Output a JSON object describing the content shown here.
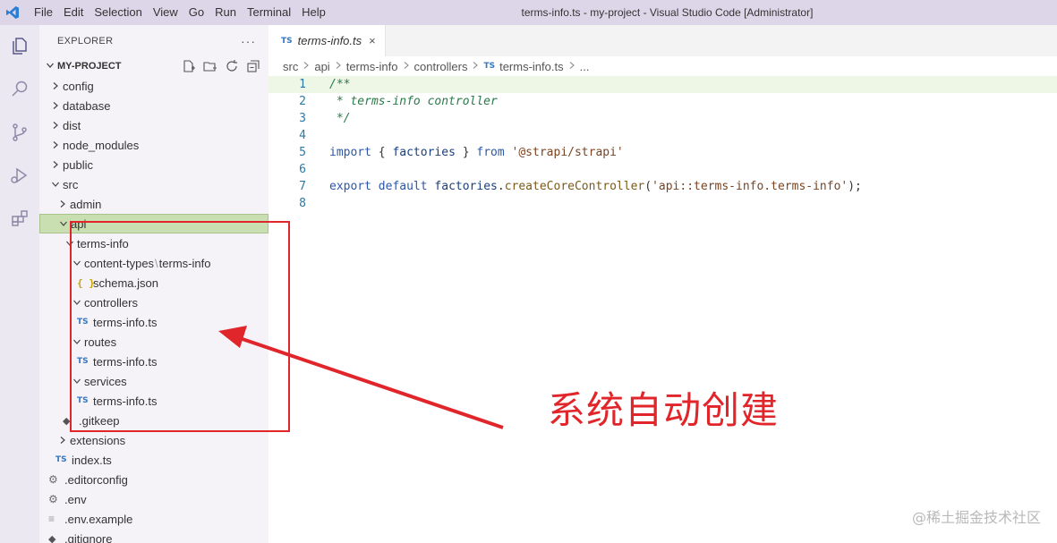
{
  "titlebar": {
    "menu": [
      "File",
      "Edit",
      "Selection",
      "View",
      "Go",
      "Run",
      "Terminal",
      "Help"
    ],
    "title": "terms-info.ts - my-project - Visual Studio Code [Administrator]"
  },
  "activity_bar": {
    "icons": [
      "files-icon",
      "search-icon",
      "source-control-icon",
      "run-debug-icon",
      "extensions-icon"
    ]
  },
  "explorer": {
    "header": "EXPLORER",
    "more": "···",
    "project": "MY-PROJECT",
    "tree": [
      {
        "label": "config",
        "type": "folder",
        "expanded": false
      },
      {
        "label": "database",
        "type": "folder",
        "expanded": false
      },
      {
        "label": "dist",
        "type": "folder",
        "expanded": false
      },
      {
        "label": "node_modules",
        "type": "folder",
        "expanded": false
      },
      {
        "label": "public",
        "type": "folder",
        "expanded": false
      },
      {
        "label": "src",
        "type": "folder",
        "expanded": true
      },
      {
        "label": "admin",
        "type": "folder",
        "expanded": false
      },
      {
        "label": "api",
        "type": "folder",
        "expanded": true,
        "selected": true
      },
      {
        "label": "terms-info",
        "type": "folder",
        "expanded": true
      },
      {
        "label": "content-types",
        "label2": "terms-info",
        "type": "folder",
        "expanded": true
      },
      {
        "label": "schema.json",
        "type": "json"
      },
      {
        "label": "controllers",
        "type": "folder",
        "expanded": true
      },
      {
        "label": "terms-info.ts",
        "type": "ts"
      },
      {
        "label": "routes",
        "type": "folder",
        "expanded": true
      },
      {
        "label": "terms-info.ts",
        "type": "ts"
      },
      {
        "label": "services",
        "type": "folder",
        "expanded": true
      },
      {
        "label": "terms-info.ts",
        "type": "ts"
      },
      {
        "label": ".gitkeep",
        "type": "file"
      },
      {
        "label": "extensions",
        "type": "folder",
        "expanded": false
      },
      {
        "label": "index.ts",
        "type": "ts"
      },
      {
        "label": ".editorconfig",
        "type": "config"
      },
      {
        "label": ".env",
        "type": "config"
      },
      {
        "label": ".env.example",
        "type": "text"
      },
      {
        "label": ".gitignore",
        "type": "file"
      }
    ],
    "file_badge_ts": "TS",
    "file_badge_json": "{ }"
  },
  "editor": {
    "tab": {
      "badge": "TS",
      "label": "terms-info.ts",
      "close": "×"
    },
    "breadcrumb": [
      "src",
      "api",
      "terms-info",
      "controllers",
      "terms-info.ts",
      "..."
    ],
    "lines": [
      {
        "n": "1",
        "text": "/**"
      },
      {
        "n": "2",
        "text": " * terms-info controller"
      },
      {
        "n": "3",
        "text": " */"
      },
      {
        "n": "4",
        "text": ""
      },
      {
        "n": "5",
        "text": "import { factories } from '@strapi/strapi'"
      },
      {
        "n": "6",
        "text": ""
      },
      {
        "n": "7",
        "text": "export default factories.createCoreController('api::terms-info.terms-info');"
      },
      {
        "n": "8",
        "text": ""
      }
    ]
  },
  "annotation": {
    "text": "系统自动创建",
    "color": "#e1262b"
  },
  "watermark": "@稀土掘金技术社区"
}
